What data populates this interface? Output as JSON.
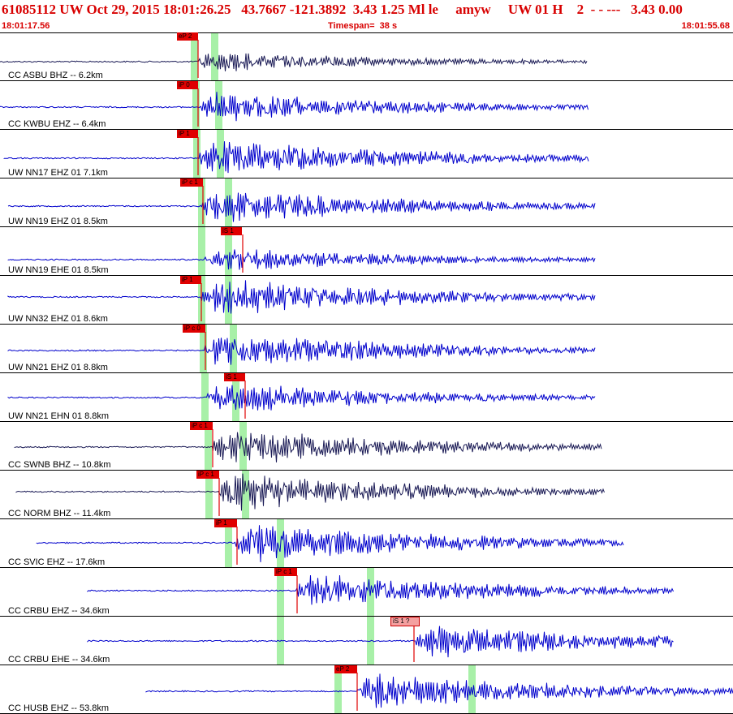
{
  "header": {
    "title": "61085112 UW Oct 29, 2015 18:01:26.25   43.7667 -121.3892  3.43 1.25 Ml le     amyw     UW 01 H    2  - - ---   3.43 0.00",
    "start_time": "18:01:17.56",
    "timespan": "Timespan=  38 s",
    "end_time": "18:01:55.68"
  },
  "colors": {
    "pick_red": "#e00000",
    "pick_light": "#f4a0a0",
    "trace_blue": "#0000cc",
    "trace_dark": "#1a1a55",
    "highlight_green": "#a8f0a8"
  },
  "traces": [
    {
      "label": "CC ASBU BHZ -- 6.2km",
      "pick": "eP 2",
      "color": "dark"
    },
    {
      "label": "CC KWBU EHZ -- 6.4km",
      "pick": "iP 0",
      "color": "blue"
    },
    {
      "label": "UW NN17 EHZ 01 7.1km",
      "pick": "iP 1",
      "color": "blue"
    },
    {
      "label": "UW NN19 EHZ 01 8.5km",
      "pick": "iP c 1",
      "color": "blue"
    },
    {
      "label": "UW NN19 EHE 01 8.5km",
      "pick": "iS 1",
      "color": "blue"
    },
    {
      "label": "UW NN32 EHZ 01 8.6km",
      "pick": "iP 1",
      "color": "blue"
    },
    {
      "label": "UW NN21 EHZ 01 8.8km",
      "pick": "iP c 0",
      "color": "blue"
    },
    {
      "label": "UW NN21 EHN 01 8.8km",
      "pick": "iS 1",
      "color": "blue"
    },
    {
      "label": "CC SWNB BHZ -- 10.8km",
      "pick": "iP c 1",
      "color": "dark"
    },
    {
      "label": "CC NORM BHZ -- 11.4km",
      "pick": "iP c 1",
      "color": "dark"
    },
    {
      "label": "CC SVIC EHZ -- 17.6km",
      "pick": "iP 1",
      "color": "blue"
    },
    {
      "label": "CC CRBU EHZ -- 34.6km",
      "pick": "iP c 1",
      "color": "blue"
    },
    {
      "label": "CC CRBU EHE -- 34.6km",
      "pick": "iS 1 ?",
      "color": "blue"
    },
    {
      "label": "CC HUSB EHZ -- 53.8km",
      "pick": "eP 2",
      "color": "blue"
    }
  ]
}
